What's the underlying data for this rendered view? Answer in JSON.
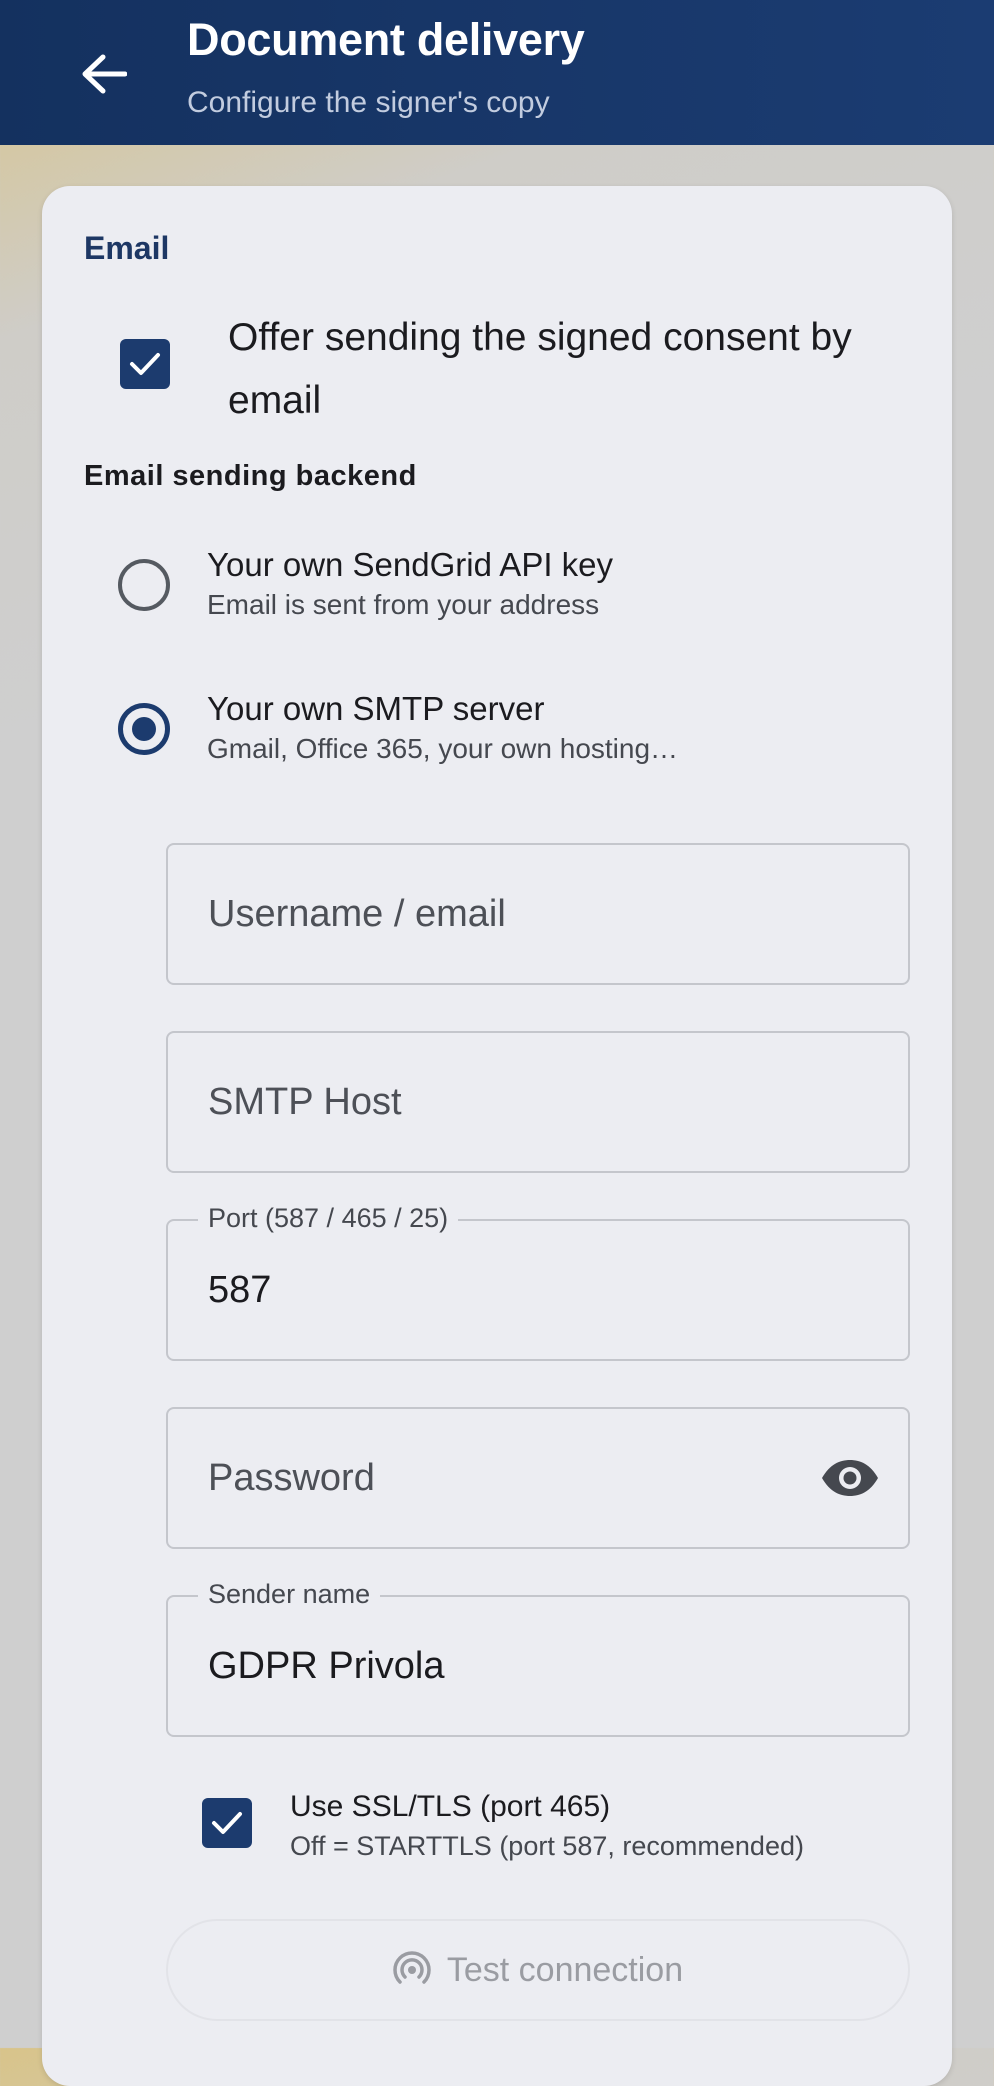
{
  "header": {
    "title": "Document delivery",
    "subtitle": "Configure the signer's copy",
    "back_icon": "arrow-back-icon"
  },
  "email_section": {
    "title": "Email",
    "offer_checkbox": {
      "label": "Offer sending the signed consent by email",
      "checked": true
    },
    "backend_label": "Email sending backend",
    "backends": [
      {
        "title": "Your own SendGrid API key",
        "subtitle": "Email is sent from your address",
        "selected": false
      },
      {
        "title": "Your own SMTP server",
        "subtitle": "Gmail, Office 365, your own hosting…",
        "selected": true
      }
    ]
  },
  "smtp": {
    "username": {
      "placeholder": "Username / email",
      "value": ""
    },
    "host": {
      "placeholder": "SMTP Host",
      "value": ""
    },
    "port": {
      "label": "Port (587 / 465 / 25)",
      "value": "587"
    },
    "password": {
      "placeholder": "Password",
      "value": "",
      "toggle_icon": "eye-icon"
    },
    "sender_name": {
      "label": "Sender name",
      "value": "GDPR Privola"
    },
    "ssl": {
      "label": "Use SSL/TLS (port 465)",
      "subtitle": "Off = STARTTLS (port 587, recommended)",
      "checked": true
    },
    "test_button": {
      "label": "Test connection",
      "icon": "broadcast-icon",
      "enabled": false
    }
  },
  "colors": {
    "primary": "#1c3b6e",
    "appbar": "#14315f",
    "card": "#ecedf2"
  }
}
